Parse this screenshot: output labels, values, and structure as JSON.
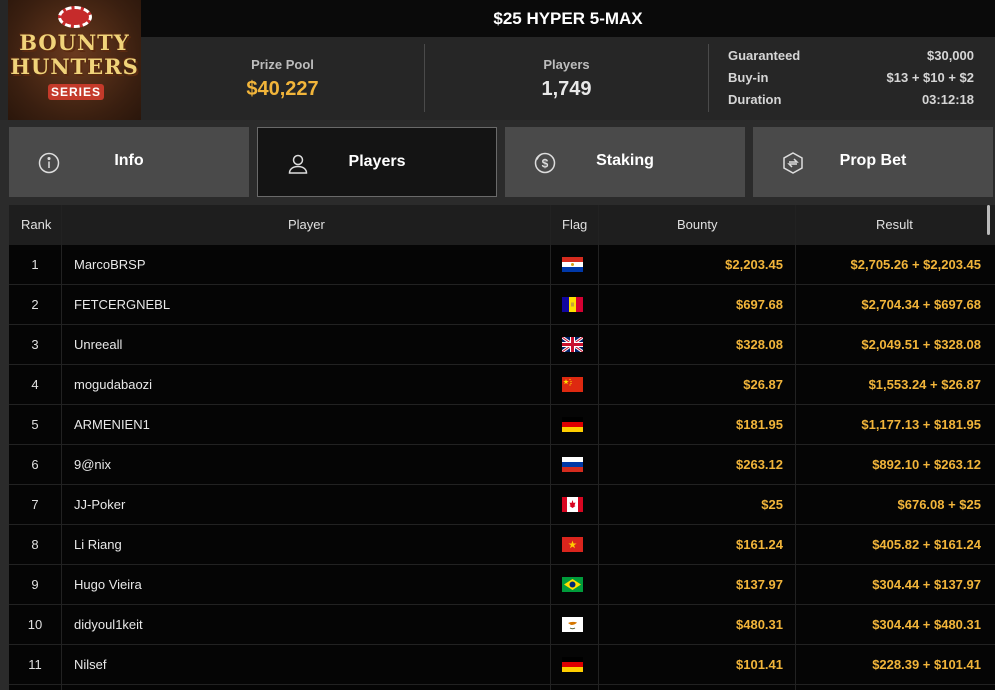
{
  "logo": {
    "line1": "BOUNTY",
    "line2": "HUNTERS",
    "line3": "SERIES"
  },
  "title": "$25 HYPER 5-MAX",
  "prize_pool": {
    "label": "Prize Pool",
    "value": "$40,227"
  },
  "players_stat": {
    "label": "Players",
    "value": "1,749"
  },
  "details": [
    {
      "label": "Guaranteed",
      "value": "$30,000"
    },
    {
      "label": "Buy-in",
      "value": "$13 + $10 + $2"
    },
    {
      "label": "Duration",
      "value": "03:12:18"
    }
  ],
  "tabs": [
    {
      "label": "Info",
      "icon": "info-icon",
      "active": false
    },
    {
      "label": "Players",
      "icon": "user-icon",
      "active": true
    },
    {
      "label": "Staking",
      "icon": "coin-dollar-icon",
      "active": false
    },
    {
      "label": "Prop Bet",
      "icon": "prop-bet-icon",
      "active": false
    }
  ],
  "table": {
    "headers": {
      "rank": "Rank",
      "player": "Player",
      "flag": "Flag",
      "bounty": "Bounty",
      "result": "Result"
    },
    "rows": [
      {
        "rank": "1",
        "player": "MarcoBRSP",
        "flag": "paraguay",
        "bounty": "$2,203.45",
        "result": "$2,705.26 + $2,203.45"
      },
      {
        "rank": "2",
        "player": "FETCERGNEBL",
        "flag": "andorra",
        "bounty": "$697.68",
        "result": "$2,704.34 + $697.68"
      },
      {
        "rank": "3",
        "player": "Unreeall",
        "flag": "united-kingdom",
        "bounty": "$328.08",
        "result": "$2,049.51 + $328.08"
      },
      {
        "rank": "4",
        "player": "mogudabaozi",
        "flag": "china",
        "bounty": "$26.87",
        "result": "$1,553.24 + $26.87"
      },
      {
        "rank": "5",
        "player": "ARMENIEN1",
        "flag": "germany",
        "bounty": "$181.95",
        "result": "$1,177.13 + $181.95"
      },
      {
        "rank": "6",
        "player": "9@nix",
        "flag": "russia",
        "bounty": "$263.12",
        "result": "$892.10 + $263.12"
      },
      {
        "rank": "7",
        "player": "JJ-Poker",
        "flag": "canada",
        "bounty": "$25",
        "result": "$676.08 + $25"
      },
      {
        "rank": "8",
        "player": "Li Riang",
        "flag": "vietnam",
        "bounty": "$161.24",
        "result": "$405.82 + $161.24"
      },
      {
        "rank": "9",
        "player": "Hugo Vieira",
        "flag": "brazil",
        "bounty": "$137.97",
        "result": "$304.44 + $137.97"
      },
      {
        "rank": "10",
        "player": "didyoul1keit",
        "flag": "cyprus",
        "bounty": "$480.31",
        "result": "$304.44 + $480.31"
      },
      {
        "rank": "11",
        "player": "Nilsef",
        "flag": "germany",
        "bounty": "$101.41",
        "result": "$228.39 + $101.41"
      }
    ]
  },
  "colors": {
    "accent_gold": "#f2b53a",
    "tab_bg": "#4a4a4a",
    "tab_active_bg": "#141414"
  }
}
